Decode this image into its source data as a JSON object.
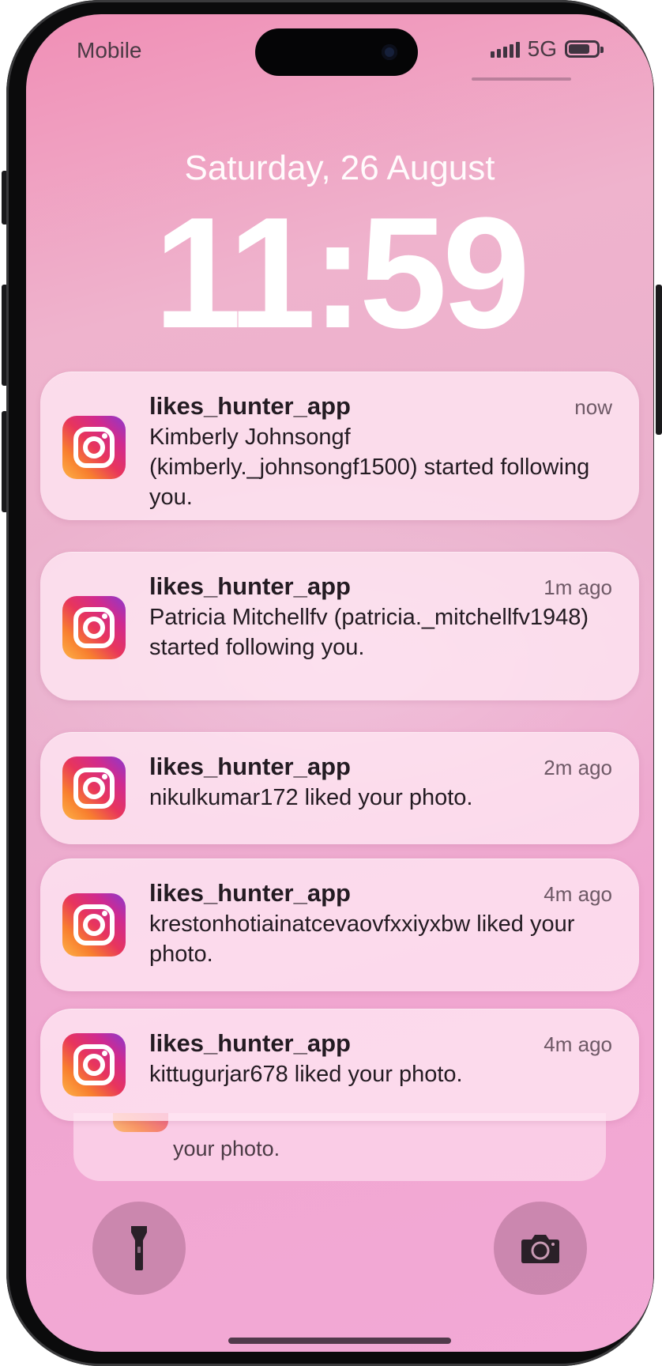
{
  "status_bar": {
    "carrier": "Mobile",
    "network": "5G",
    "battery_level": 0.75
  },
  "lock_screen": {
    "date": "Saturday, 26 August",
    "time": "11:59"
  },
  "notifications": [
    {
      "app": "likes_hunter_app",
      "time": "now",
      "body": "Kimberly  Johnsongf (kimberly._johnsongf1500) started following you.",
      "icon": "instagram-icon"
    },
    {
      "app": "likes_hunter_app",
      "time": "1m ago",
      "body": "Patricia  Mitchellfv (patricia._mitchellfv1948) started following you.",
      "icon": "instagram-icon"
    },
    {
      "app": "likes_hunter_app",
      "time": "2m ago",
      "body": "nikulkumar172 liked your photo.",
      "icon": "instagram-icon"
    },
    {
      "app": "likes_hunter_app",
      "time": "4m ago",
      "body": "krestonhotiainatcevaovfxxiyxbw liked your photo.",
      "icon": "instagram-icon"
    },
    {
      "app": "likes_hunter_app",
      "time": "4m ago",
      "body": "kittugurjar678 liked your photo.",
      "icon": "instagram-icon"
    }
  ],
  "stacked_notification": {
    "body": "your photo."
  },
  "quick_actions": {
    "left": "flashlight-icon",
    "right": "camera-icon"
  },
  "colors": {
    "wallpaper_top": "#f08fb6",
    "wallpaper_bottom": "#f3a9d6",
    "card_background": "#ffe8f4"
  }
}
